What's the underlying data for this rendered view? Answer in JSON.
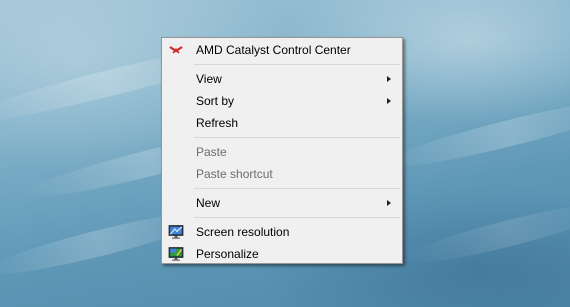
{
  "menu": {
    "items": [
      {
        "label": "AMD Catalyst Control Center",
        "icon": "amd-catalyst-icon",
        "enabled": true
      },
      {
        "label": "View",
        "submenu": true,
        "enabled": true
      },
      {
        "label": "Sort by",
        "submenu": true,
        "enabled": true
      },
      {
        "label": "Refresh",
        "enabled": true
      },
      {
        "label": "Paste",
        "enabled": false
      },
      {
        "label": "Paste shortcut",
        "enabled": false
      },
      {
        "label": "New",
        "submenu": true,
        "enabled": true
      },
      {
        "label": "Screen resolution",
        "icon": "screen-resolution-icon",
        "enabled": true
      },
      {
        "label": "Personalize",
        "icon": "personalize-icon",
        "enabled": true
      }
    ]
  },
  "colors": {
    "menu_background": "#f0f0f0",
    "menu_border": "#979797",
    "disabled_text": "#6d6d6d",
    "desktop_blue": "#6ea3c0"
  }
}
